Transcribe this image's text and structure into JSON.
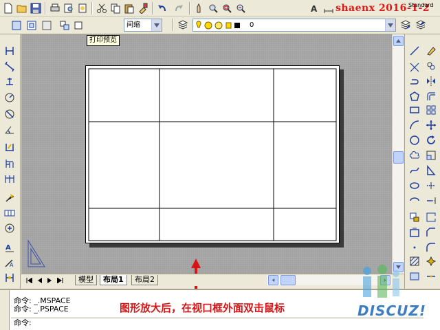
{
  "watermark": "shaenx 2016-1-2",
  "style_label": "Standard",
  "layer_combo": {
    "value": "0"
  },
  "view_combo": {
    "value": "间缩"
  },
  "tooltip": "打印预览",
  "tabs": [
    "模型",
    "布局1",
    "布局2"
  ],
  "active_tab": "布局1",
  "command_lines": [
    "命令: _.MSPACE",
    "命令: _.PSPACE",
    "命令:"
  ],
  "annotation": "图形放大后，在视口框外面双击鼠标",
  "logo": "DISCUZ!",
  "colors": {
    "canvas": "#a9a9a9",
    "annotation": "#d81414",
    "watermark": "#e01818",
    "arrow": "#d81414"
  },
  "icons": {
    "toolbar1": [
      "new-icon",
      "open-icon",
      "save-icon",
      "print-icon",
      "print-preview-icon",
      "publish-icon",
      "cut-icon",
      "copy-icon",
      "paste-icon",
      "match-properties-icon",
      "undo-icon",
      "redo-icon",
      "pan-icon",
      "zoom-realtime-icon",
      "zoom-window-icon",
      "zoom-previous-icon",
      "text-style-icon",
      "dim-style-icon"
    ],
    "left": [
      "linear-dim-icon",
      "aligned-dim-icon",
      "ordinate-dim-icon",
      "radius-dim-icon",
      "diameter-dim-icon",
      "angular-dim-icon",
      "quick-dim-icon",
      "baseline-dim-icon",
      "continue-dim-icon",
      "leader-icon",
      "tolerance-icon",
      "center-mark-icon",
      "dim-edit-icon",
      "dim-text-edit-icon",
      "dim-update-icon"
    ],
    "right": [
      "line-icon",
      "construction-line-icon",
      "polyline-icon",
      "polygon-icon",
      "rectangle-icon",
      "arc-icon",
      "circle-icon",
      "revision-cloud-icon",
      "spline-icon",
      "ellipse-icon",
      "ellipse-arc-icon",
      "insert-block-icon",
      "make-block-icon",
      "point-icon",
      "hatch-icon",
      "gradient-icon",
      "region-icon",
      "table-icon",
      "mtext-icon"
    ]
  }
}
